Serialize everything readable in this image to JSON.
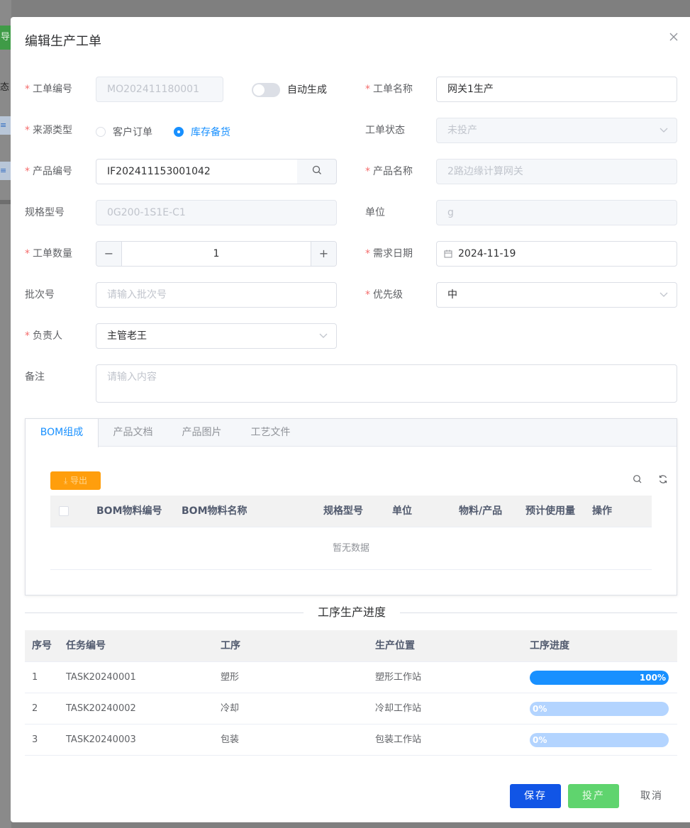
{
  "background": {
    "green_tab_char": "导",
    "status_char": "态",
    "blue1": "≡",
    "blue2": "≡"
  },
  "dialog": {
    "title": "编辑生产工单"
  },
  "form": {
    "order_no": {
      "label": "工单编号",
      "value": "MO202411180001"
    },
    "auto_generate": {
      "label": "自动生成",
      "on": false
    },
    "order_name": {
      "label": "工单名称",
      "value": "网关1生产"
    },
    "source_type": {
      "label": "来源类型",
      "options": [
        "客户订单",
        "库存备货"
      ],
      "selected": "库存备货"
    },
    "order_status": {
      "label": "工单状态",
      "value": "未投产"
    },
    "product_code": {
      "label": "产品编号",
      "value": "IF202411153001042"
    },
    "product_name": {
      "label": "产品名称",
      "value": "2路边缘计算网关"
    },
    "spec": {
      "label": "规格型号",
      "value": "0G200-1S1E-C1"
    },
    "unit": {
      "label": "单位",
      "value": "g"
    },
    "quantity": {
      "label": "工单数量",
      "value": "1"
    },
    "need_date": {
      "label": "需求日期",
      "value": "2024-11-19"
    },
    "batch_no": {
      "label": "批次号",
      "placeholder": "请输入批次号"
    },
    "priority": {
      "label": "优先级",
      "value": "中"
    },
    "owner": {
      "label": "负责人",
      "value": "主管老王"
    },
    "remark": {
      "label": "备注",
      "placeholder": "请输入内容"
    }
  },
  "tabs": [
    "BOM组成",
    "产品文档",
    "产品图片",
    "工艺文件"
  ],
  "bom": {
    "export_label": "导出",
    "columns": [
      "BOM物料编号",
      "BOM物料名称",
      "规格型号",
      "单位",
      "物料/产品",
      "预计使用量",
      "操作"
    ],
    "empty_text": "暂无数据"
  },
  "progress": {
    "section_title": "工序生产进度",
    "columns": [
      "序号",
      "任务编号",
      "工序",
      "生产位置",
      "工序进度"
    ],
    "rows": [
      {
        "index": "1",
        "task": "TASK20240001",
        "process": "塑形",
        "location": "塑形工作站",
        "percent": 100,
        "percent_label": "100%"
      },
      {
        "index": "2",
        "task": "TASK20240002",
        "process": "冷却",
        "location": "冷却工作站",
        "percent": 0,
        "percent_label": "0%"
      },
      {
        "index": "3",
        "task": "TASK20240003",
        "process": "包装",
        "location": "包装工作站",
        "percent": 0,
        "percent_label": "0%"
      }
    ]
  },
  "footer": {
    "save": "保存",
    "launch": "投产",
    "cancel": "取消"
  },
  "colors": {
    "primary": "#1890ff",
    "save": "#1155e6",
    "launch": "#5fd46e",
    "required": "#f56c6c",
    "export": "#ff9900"
  }
}
